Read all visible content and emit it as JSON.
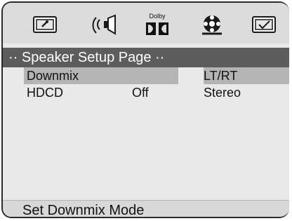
{
  "icons": [
    {
      "name": "general-setup-icon"
    },
    {
      "name": "speaker-setup-icon"
    },
    {
      "name": "dolby-digital-icon",
      "label": "Dolby"
    },
    {
      "name": "video-setup-icon"
    },
    {
      "name": "preferences-icon"
    }
  ],
  "page": {
    "title": "·· Speaker Setup Page ··"
  },
  "settings": [
    {
      "label": "Downmix",
      "value": ""
    },
    {
      "label": "HDCD",
      "value": "Off"
    }
  ],
  "options": [
    "LT/RT",
    "Stereo"
  ],
  "status": {
    "text": "Set Downmix Mode"
  }
}
